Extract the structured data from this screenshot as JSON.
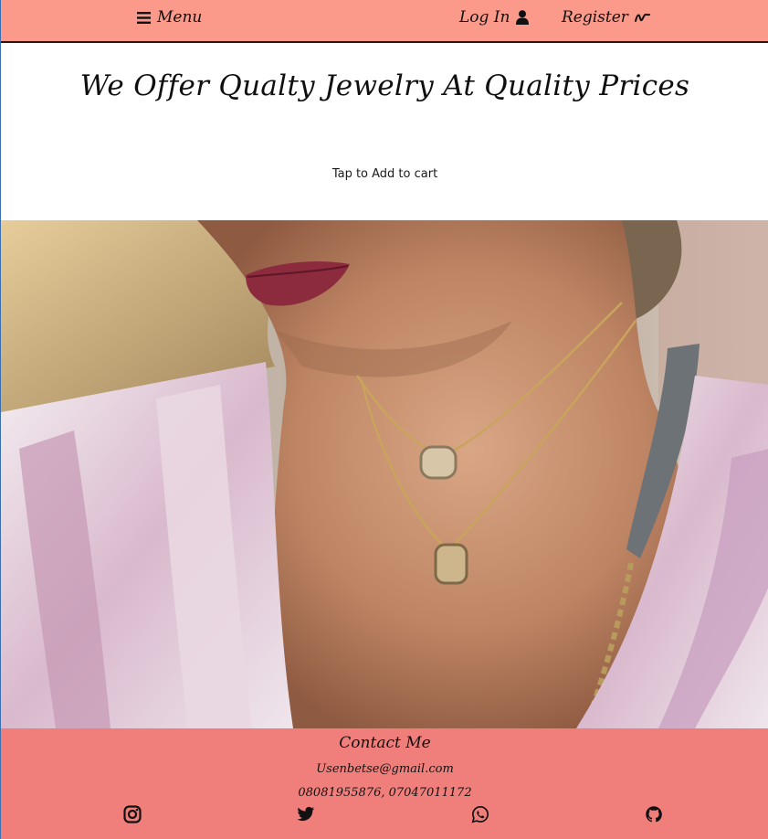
{
  "navbar": {
    "menu_label": "Menu",
    "login_label": "Log In",
    "register_label": "Register",
    "background": "#fb9a8a"
  },
  "hero": {
    "title": "We Offer Qualty Jewelry At Quality Prices",
    "tap_hint": "Tap to Add to cart"
  },
  "footer": {
    "contact_title": "Contact Me",
    "email": "Usenbetse@gmail.com",
    "phones": "08081955876, 07047011172",
    "background": "#f07e7a",
    "social_icons": [
      "instagram-icon",
      "twitter-icon",
      "whatsapp-icon",
      "github-icon"
    ]
  }
}
